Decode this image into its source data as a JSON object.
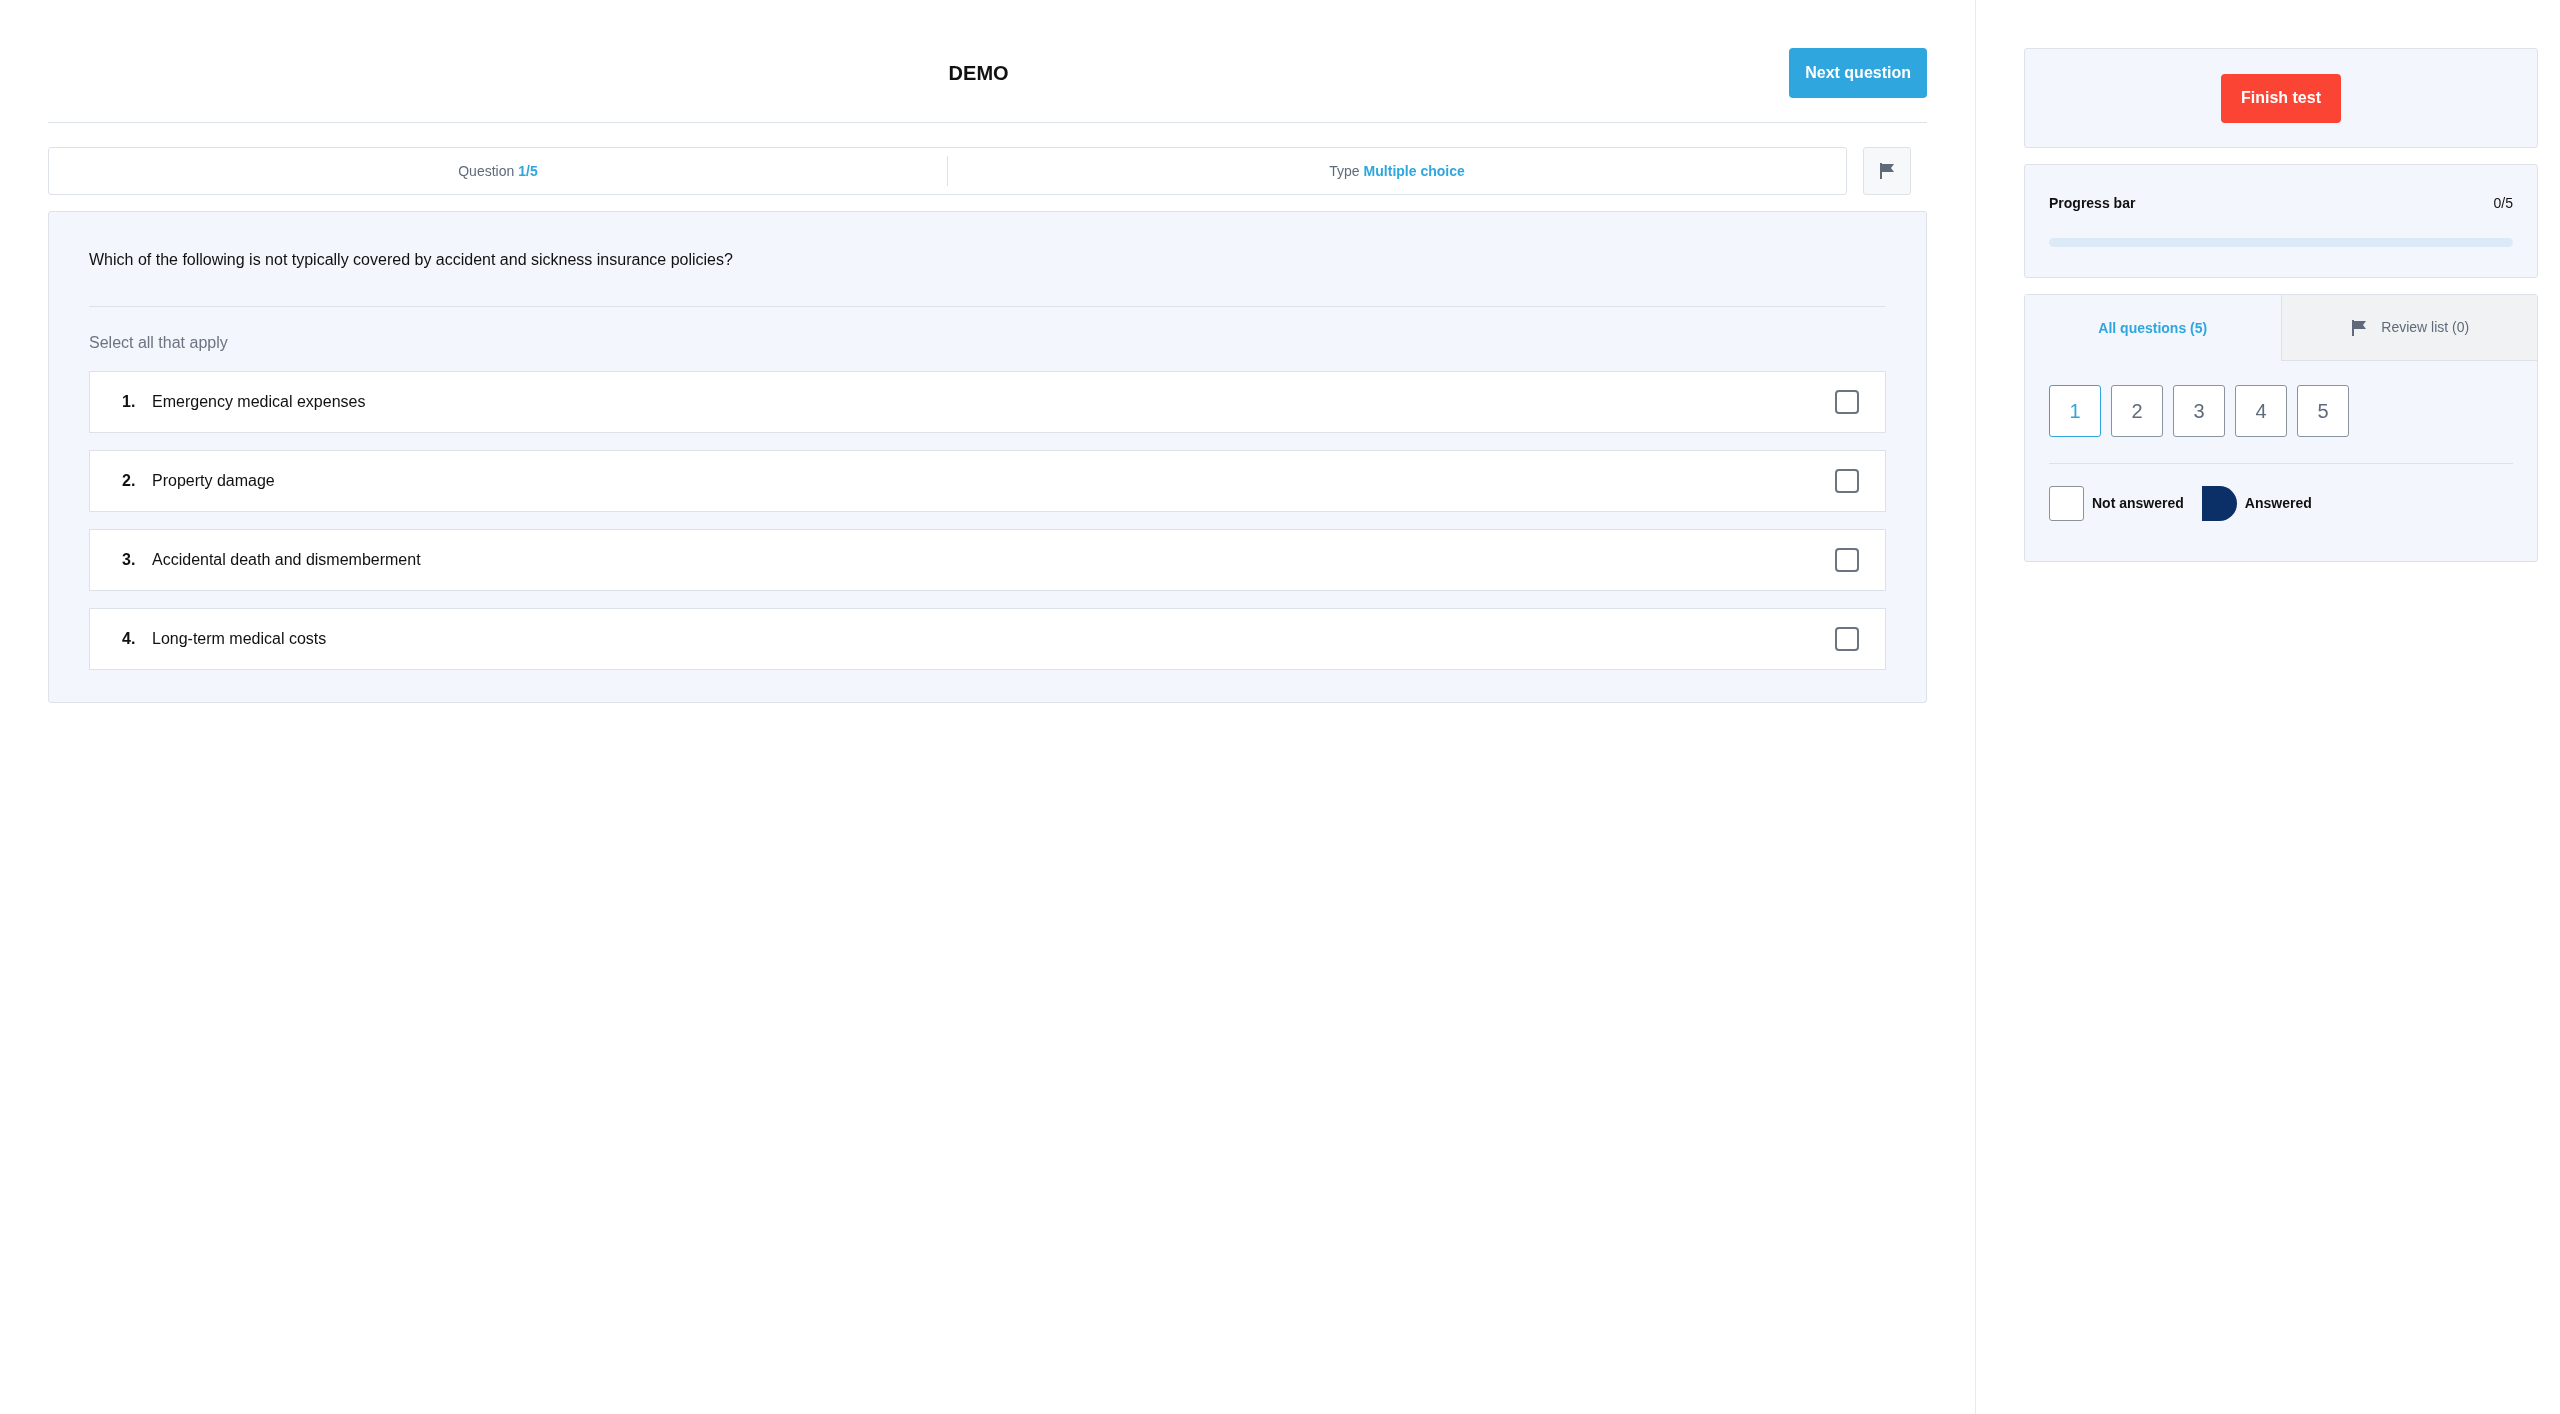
{
  "header": {
    "title": "DEMO",
    "next_button": "Next question"
  },
  "info": [
    {
      "label": "Question",
      "value": "1/5"
    },
    {
      "label": "Type",
      "value": "Multiple choice"
    }
  ],
  "question": {
    "text": "Which of the following is not typically covered by accident and sickness insurance policies?",
    "hint": "Select all that apply",
    "options": [
      {
        "number": "1.",
        "text": "Emergency medical expenses",
        "checked": false
      },
      {
        "number": "2.",
        "text": "Property damage",
        "checked": false
      },
      {
        "number": "3.",
        "text": "Accidental death and dismemberment",
        "checked": false
      },
      {
        "number": "4.",
        "text": "Long-term medical costs",
        "checked": false
      }
    ]
  },
  "sidebar": {
    "finish_button": "Finish test",
    "progress": {
      "label": "Progress bar",
      "count": "0/5",
      "level": 0
    },
    "tabs": [
      {
        "label": "All questions (5)",
        "selected": true,
        "kind": "plain"
      },
      {
        "label": "Review list (0)",
        "selected": false,
        "kind": "flag"
      }
    ],
    "questions": [
      {
        "label": "1",
        "selected": true
      },
      {
        "label": "2",
        "selected": false
      },
      {
        "label": "3",
        "selected": false
      },
      {
        "label": "4",
        "selected": false
      },
      {
        "label": "5",
        "selected": false
      }
    ],
    "legend": [
      {
        "kind": "not_answered",
        "label": "Not answered"
      },
      {
        "kind": "answered",
        "label": "Answered"
      }
    ]
  }
}
